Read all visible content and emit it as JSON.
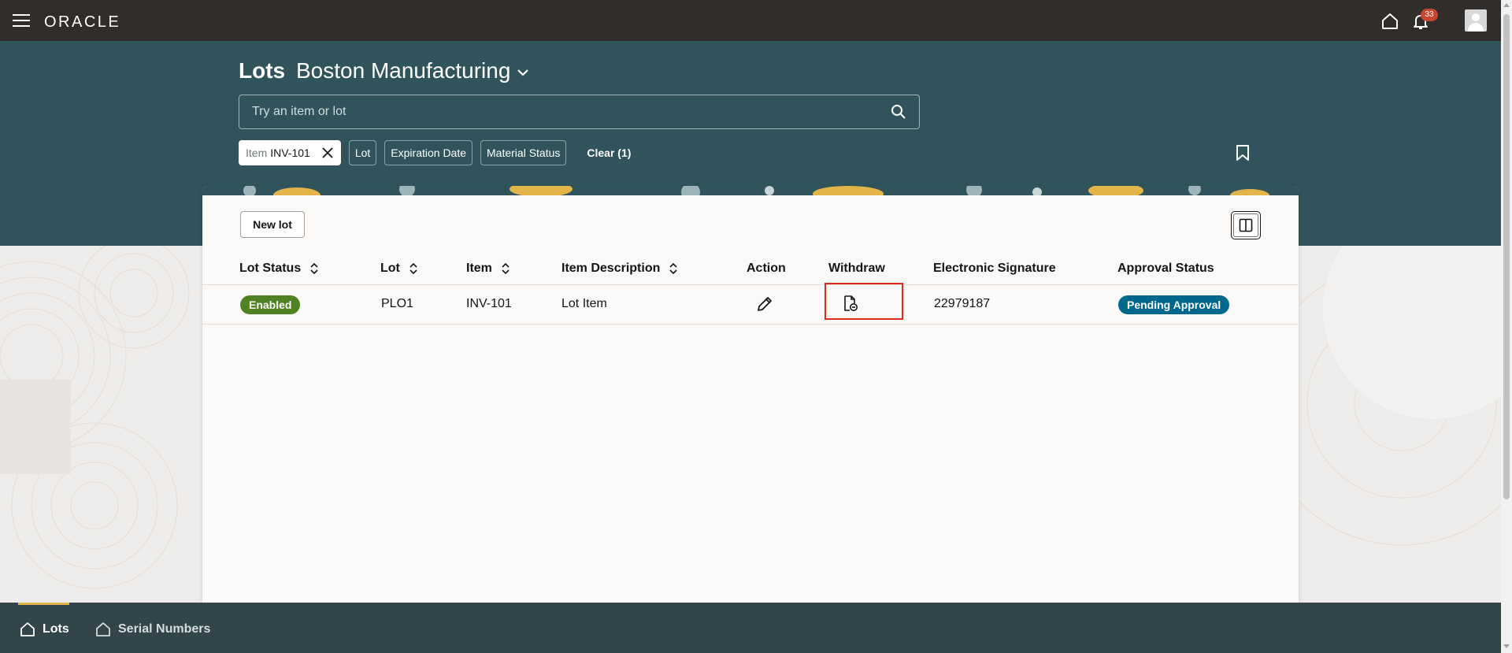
{
  "header": {
    "logo": "ORACLE",
    "notifications_count": "33",
    "icons": [
      "hamburger-menu-icon",
      "home-icon",
      "bell-icon",
      "user-avatar"
    ]
  },
  "page": {
    "title": "Lots",
    "organization": "Boston Manufacturing"
  },
  "search": {
    "placeholder": "Try an item or lot"
  },
  "filters": {
    "selected_chip": {
      "key": "Item",
      "value": "INV-101"
    },
    "chips": [
      "Lot",
      "Expiration Date",
      "Material Status"
    ],
    "clear_label": "Clear (1)"
  },
  "toolbar": {
    "new_lot_label": "New lot"
  },
  "table": {
    "columns": [
      "Lot Status",
      "Lot",
      "Item",
      "Item Description",
      "Action",
      "Withdraw",
      "Electronic Signature",
      "Approval Status"
    ],
    "rows": [
      {
        "lot_status": "Enabled",
        "lot": "PLO1",
        "item": "INV-101",
        "item_description": "Lot Item",
        "electronic_signature": "22979187",
        "approval_status": "Pending Approval"
      }
    ]
  },
  "bottom_nav": {
    "items": [
      {
        "label": "Lots",
        "active": true
      },
      {
        "label": "Serial Numbers",
        "active": false
      }
    ]
  },
  "colors": {
    "topbar": "#312d2a",
    "hero": "#31545c",
    "enabled_badge": "#508223",
    "pending_badge": "#00688c",
    "notification_badge": "#c74634",
    "highlight_box": "#e0281e",
    "bottom_nav": "#31454b",
    "bottom_nav_accent": "#e3b44a"
  }
}
